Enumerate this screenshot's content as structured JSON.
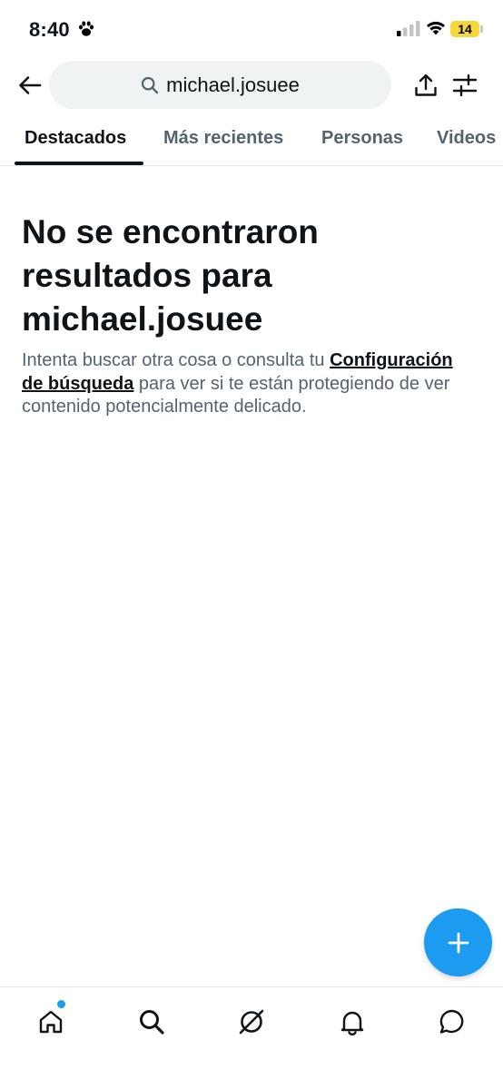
{
  "status_bar": {
    "time": "8:40",
    "battery": "14"
  },
  "search": {
    "query": "michael.josuee"
  },
  "tabs": [
    {
      "label": "Destacados",
      "active": true
    },
    {
      "label": "Más recientes",
      "active": false
    },
    {
      "label": "Personas",
      "active": false
    },
    {
      "label": "Videos",
      "active": false
    }
  ],
  "empty_state": {
    "title": "No se encontraron resultados para michael.josuee",
    "text_before": "Intenta buscar otra cosa o consulta tu ",
    "link": "Configuración de búsqueda",
    "text_after": " para ver si te están protegiendo de ver contenido potencialmente delicado."
  },
  "colors": {
    "accent": "#1d9bf0",
    "text": "#0f1419",
    "secondary": "#536471",
    "battery": "#f5d63b"
  },
  "bottom_nav": [
    "home-icon",
    "search-icon",
    "grok-icon",
    "bell-icon",
    "messages-icon"
  ]
}
